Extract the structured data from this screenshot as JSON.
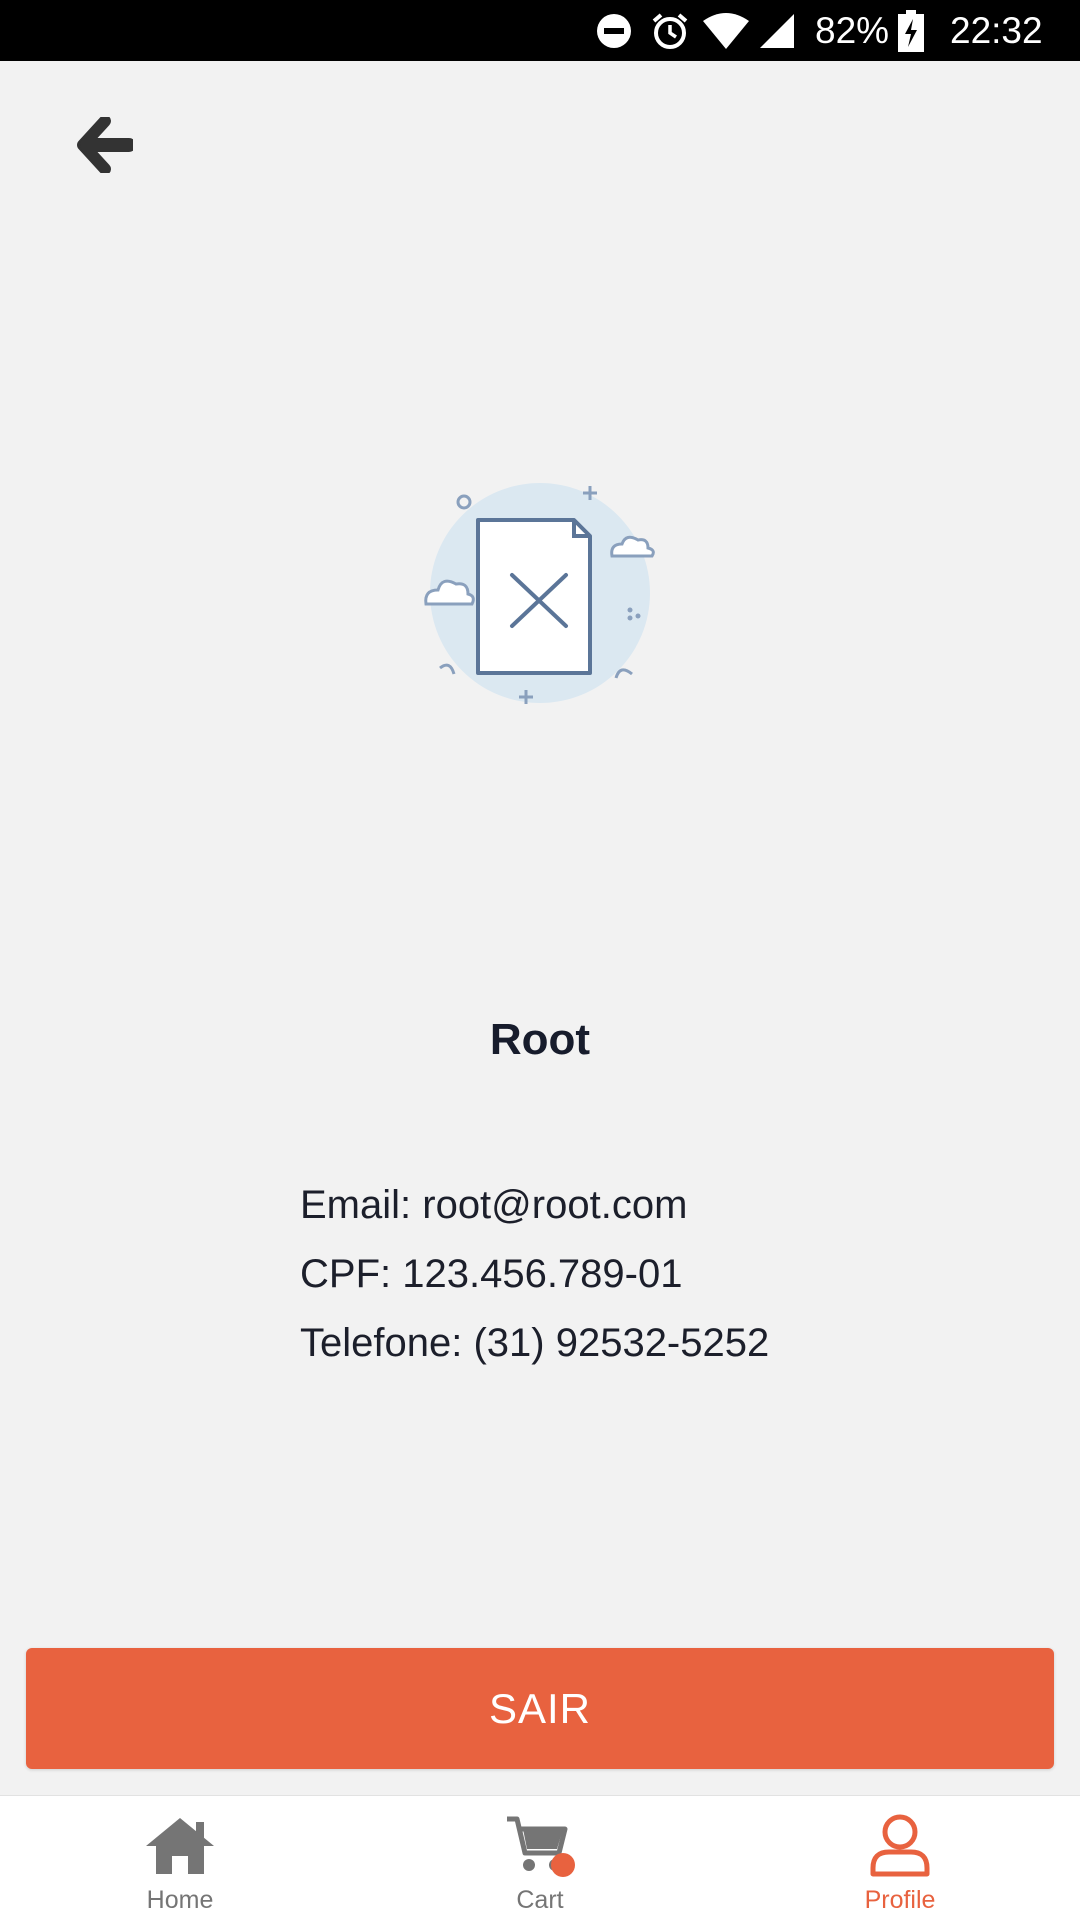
{
  "status_bar": {
    "battery_percent": "82%",
    "time": "22:32",
    "icons": [
      "do-not-disturb-icon",
      "alarm-icon",
      "wifi-icon",
      "signal-icon",
      "battery-charging-icon"
    ]
  },
  "header": {
    "back_icon": "arrow-left-icon"
  },
  "illustration": {
    "icon": "empty-document-icon"
  },
  "profile": {
    "name": "Root",
    "email_line": "Email: root@root.com",
    "cpf_line": "CPF: 123.456.789-01",
    "phone_line": "Telefone: (31) 92532-5252"
  },
  "actions": {
    "logout_label": "SAIR"
  },
  "bottom_nav": {
    "items": [
      {
        "label": "Home",
        "icon": "home-icon",
        "active": false
      },
      {
        "label": "Cart",
        "icon": "cart-icon",
        "active": false
      },
      {
        "label": "Profile",
        "icon": "user-icon",
        "active": true
      }
    ]
  },
  "colors": {
    "accent": "#e8623f",
    "background": "#f2f2f2",
    "text": "#1c1f2b",
    "inactive_nav": "#757575"
  }
}
